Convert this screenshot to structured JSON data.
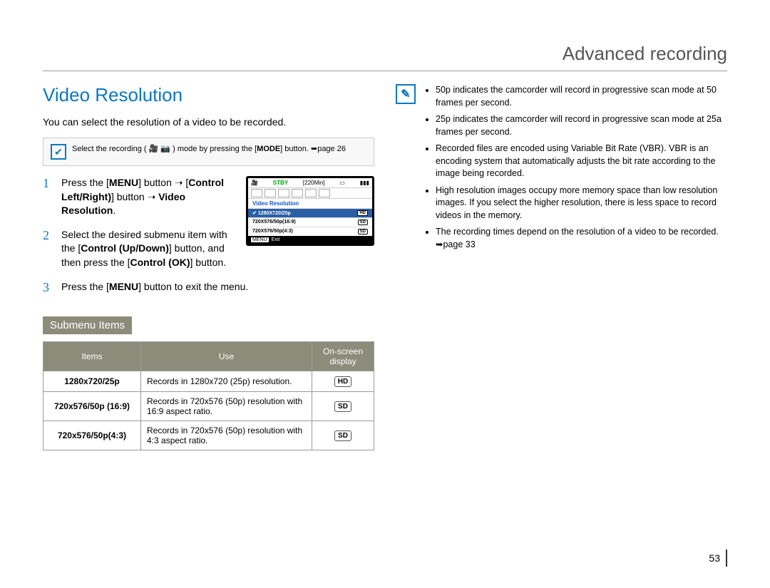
{
  "header": {
    "title": "Advanced recording"
  },
  "section": {
    "title": "Video Resolution",
    "intro": "You can select the resolution of a video to be recorded.",
    "note_prefix": "Select the recording (",
    "note_suffix": ") mode by pressing the [",
    "note_bold": "MODE",
    "note_after": "] button. ➥page 26"
  },
  "steps": {
    "s1_num": "1",
    "s1_a": "Press the [",
    "s1_b": "MENU",
    "s1_c": "] button ➝ [",
    "s1_d": "Control Left/Right)",
    "s1_e": "] button ➝ ",
    "s1_f": "Video Resolution",
    "s1_g": ".",
    "s2_num": "2",
    "s2_a": "Select the desired submenu item with the [",
    "s2_b": "Control (Up/Down)",
    "s2_c": "] button, and then press the [",
    "s2_d": "Control (OK)",
    "s2_e": "] button.",
    "s3_num": "3",
    "s3_a": "Press the [",
    "s3_b": "MENU",
    "s3_c": "] button to exit the menu."
  },
  "lcd": {
    "stby": "STBY",
    "time": "[220Min]",
    "menu_title": "Video Resolution",
    "items": [
      {
        "label": "1280X720/25p",
        "badge": "HD",
        "selected": true
      },
      {
        "label": "720X576/50p(16:9)",
        "badge": "SD",
        "selected": false
      },
      {
        "label": "720X576/50p(4:3)",
        "badge": "SD",
        "selected": false
      }
    ],
    "exit_label": "Exit",
    "menu_btn": "MENU"
  },
  "submenu": {
    "heading": "Submenu Items",
    "cols": [
      "Items",
      "Use",
      "On-screen display"
    ],
    "rows": [
      {
        "item": "1280x720/25p",
        "use": "Records in 1280x720 (25p) resolution.",
        "disp": "HD"
      },
      {
        "item": "720x576/50p (16:9)",
        "use": "Records in 720x576 (50p) resolution with 16:9 aspect ratio.",
        "disp": "SD"
      },
      {
        "item": "720x576/50p(4:3)",
        "use": "Records in 720x576 (50p) resolution with 4:3 aspect ratio.",
        "disp": "SD"
      }
    ]
  },
  "notes": [
    "50p indicates the camcorder will record in progressive scan mode at 50 frames per second.",
    "25p indicates the camcorder will record in progressive scan mode at 25a frames per second.",
    "Recorded files are encoded using Variable Bit Rate (VBR). VBR is an encoding system that automatically adjusts the bit rate according to the image being recorded.",
    "High resolution images occupy more memory space than low resolution images. If you select the higher resolution, there is less space to record videos in the memory.",
    "The recording times depend on the resolution of a video to be recorded. ➥page 33"
  ],
  "page_number": "53",
  "chart_data": {
    "type": "table",
    "title": "Submenu Items",
    "columns": [
      "Items",
      "Use",
      "On-screen display"
    ],
    "rows": [
      [
        "1280x720/25p",
        "Records in 1280x720 (25p) resolution.",
        "HD"
      ],
      [
        "720x576/50p (16:9)",
        "Records in 720x576 (50p) resolution with 16:9 aspect ratio.",
        "SD"
      ],
      [
        "720x576/50p(4:3)",
        "Records in 720x576 (50p) resolution with 4:3 aspect ratio.",
        "SD"
      ]
    ]
  }
}
